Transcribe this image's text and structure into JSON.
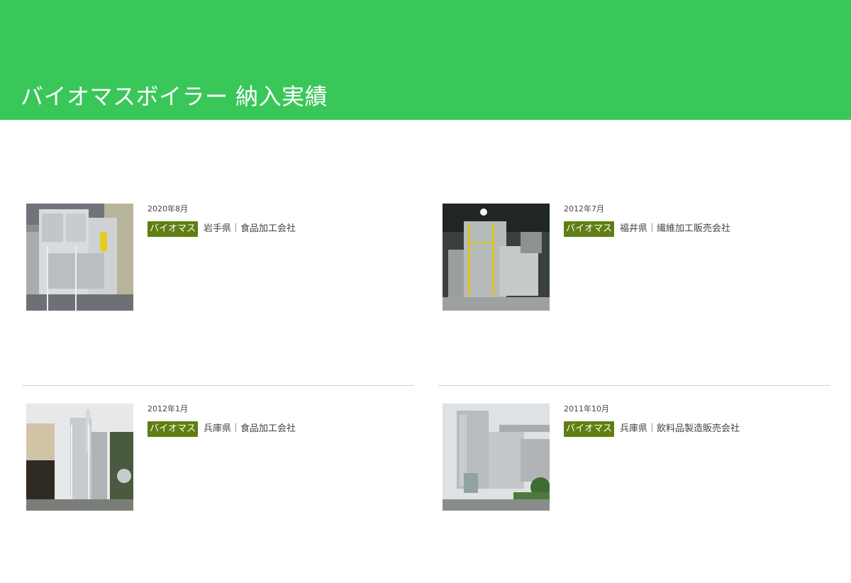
{
  "header": {
    "title": "バイオマスボイラー 納入実績",
    "background_color": "#3ac75a"
  },
  "tag_color": "#5f7f12",
  "records": [
    {
      "date": "2020年8月",
      "tag": "バイオマス",
      "place": "岩手県｜食品加工会社"
    },
    {
      "date": "2012年7月",
      "tag": "バイオマス",
      "place": "福井県｜繊維加工販売会社"
    },
    {
      "date": "2012年1月",
      "tag": "バイオマス",
      "place": "兵庫県｜食品加工会社"
    },
    {
      "date": "2011年10月",
      "tag": "バイオマス",
      "place": "兵庫県｜飲料品製造販売会社"
    }
  ]
}
